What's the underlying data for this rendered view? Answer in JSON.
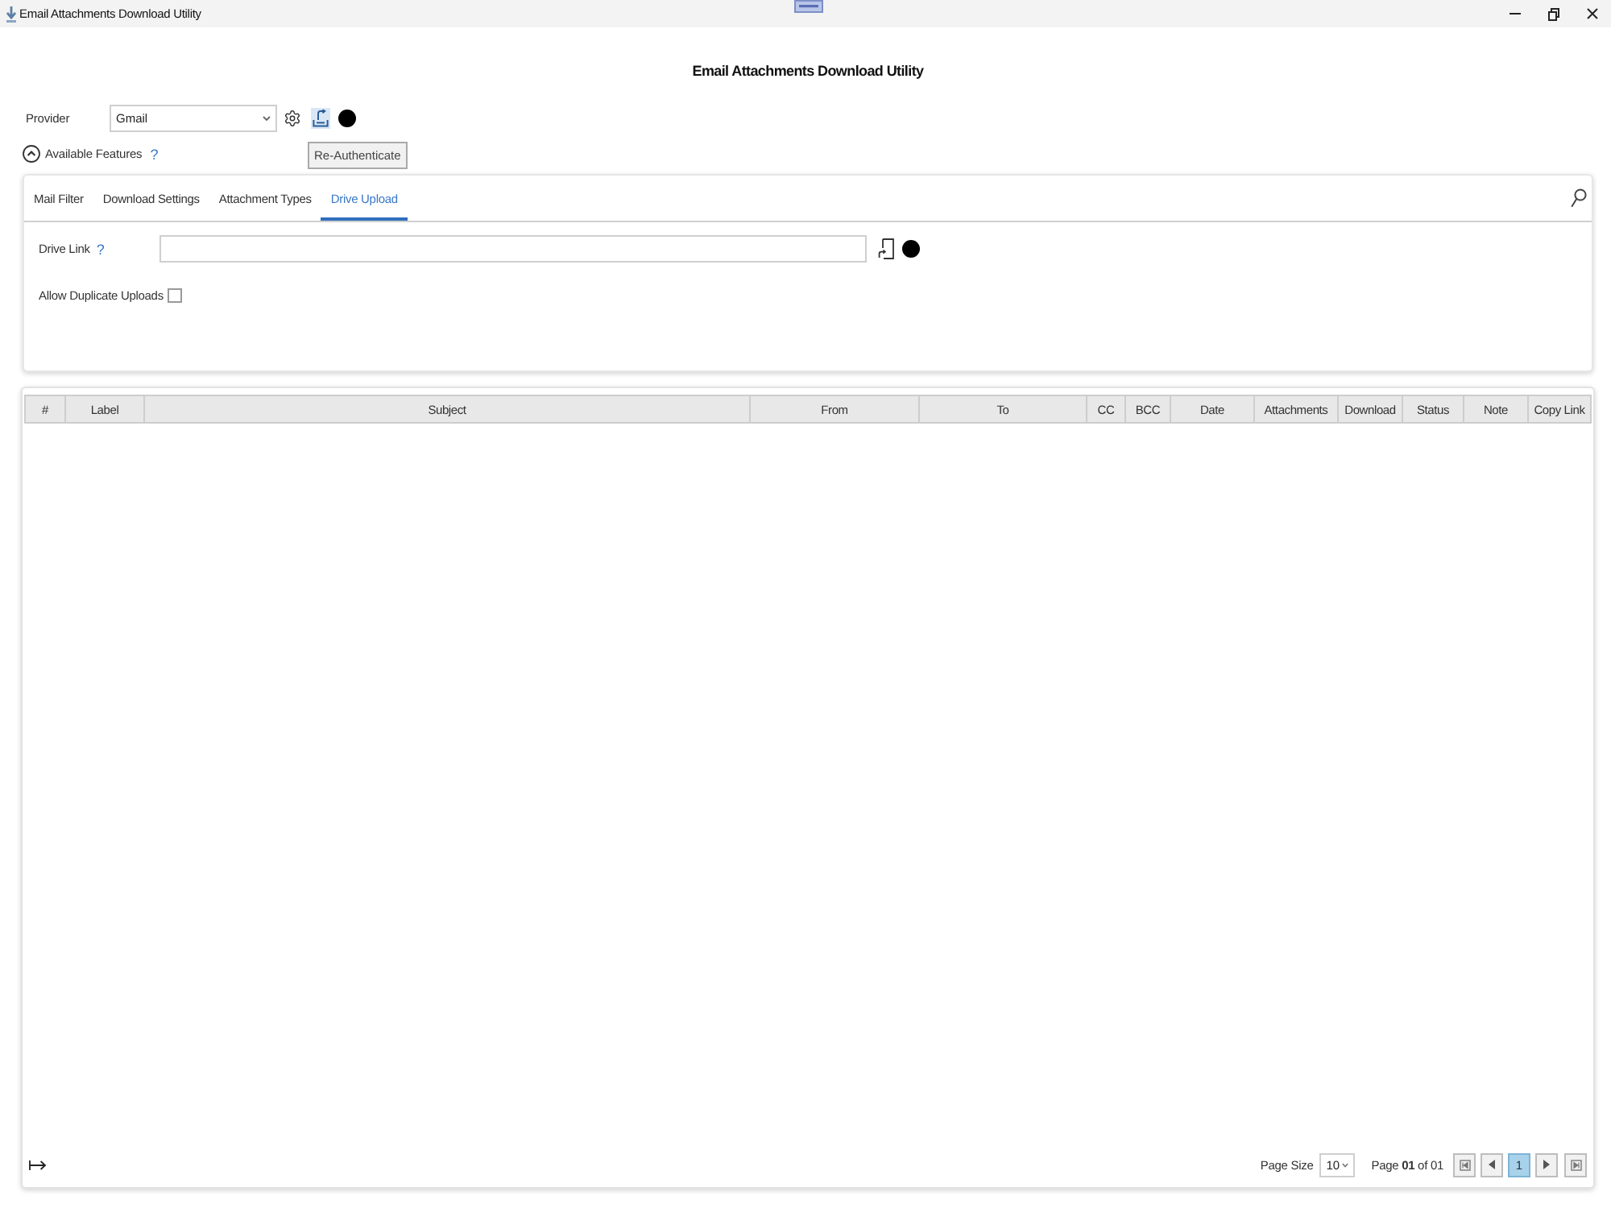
{
  "window": {
    "title": "Email Attachments Download Utility"
  },
  "heading": "Email Attachments Download Utility",
  "provider": {
    "label": "Provider",
    "value": "Gmail"
  },
  "tooltip": {
    "text": "Re-Authenticate"
  },
  "features": {
    "label": "Available Features",
    "help": "?",
    "expanded": true
  },
  "tabs": [
    {
      "label": "Mail Filter",
      "selected": false
    },
    {
      "label": "Download Settings",
      "selected": false
    },
    {
      "label": "Attachment Types",
      "selected": false
    },
    {
      "label": "Drive Upload",
      "selected": true
    }
  ],
  "drive_upload": {
    "drive_link": {
      "label": "Drive Link",
      "help": "?"
    },
    "allow_duplicates": {
      "label": "Allow Duplicate Uploads",
      "checked": false
    }
  },
  "table": {
    "columns": [
      "#",
      "Label",
      "Subject",
      "From",
      "To",
      "CC",
      "BCC",
      "Date",
      "Attachments",
      "Download",
      "Status",
      "Note",
      "Copy Link"
    ]
  },
  "pagination": {
    "page_size_label": "Page Size",
    "page_size": "10",
    "page_info": "Page **01** of 01",
    "pages": [
      {
        "label": "1",
        "selected": true
      }
    ]
  }
}
